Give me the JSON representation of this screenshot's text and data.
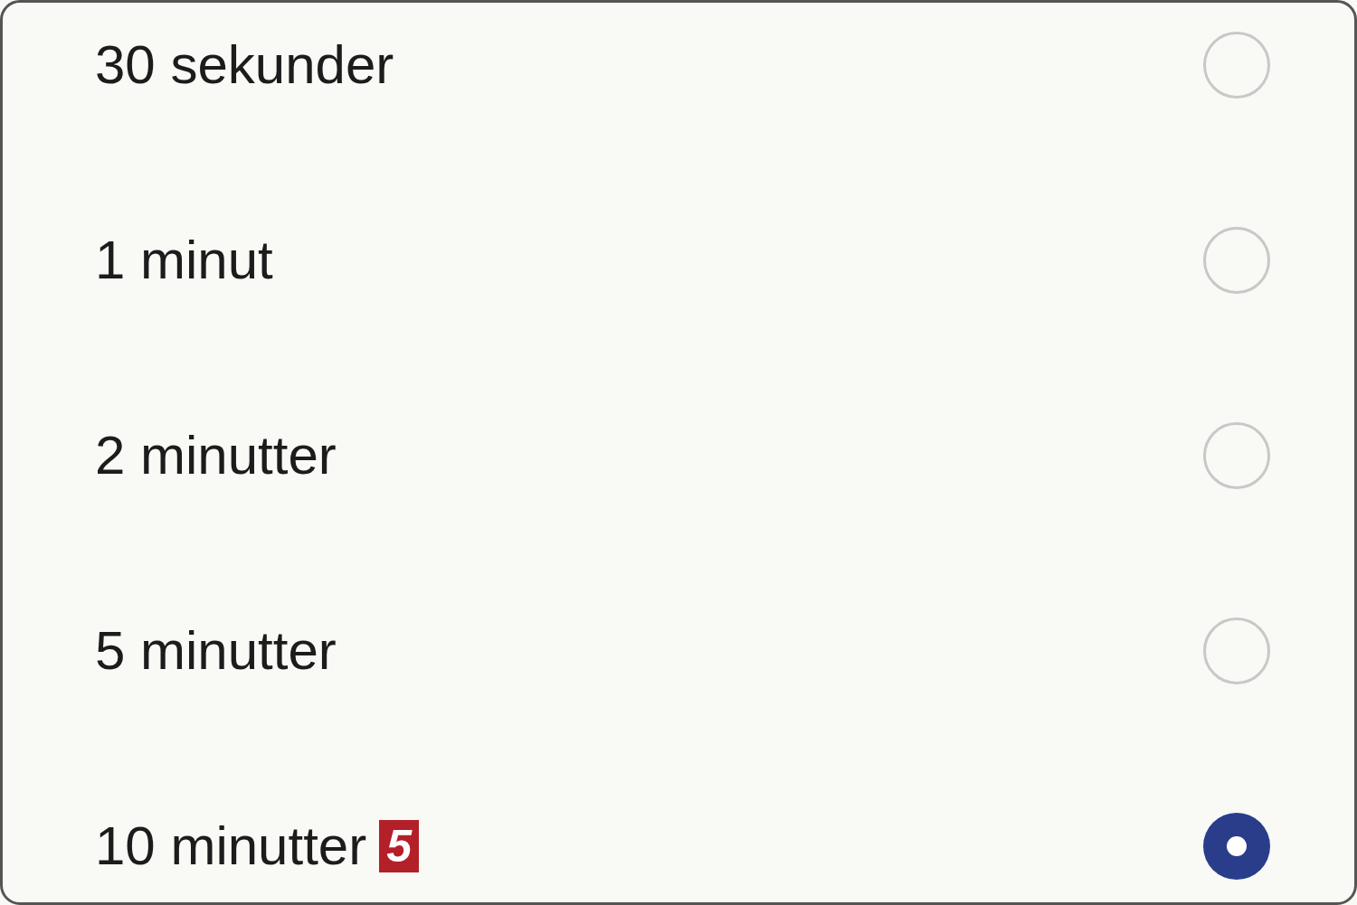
{
  "options": [
    {
      "label": "30 sekunder",
      "selected": false
    },
    {
      "label": "1 minut",
      "selected": false
    },
    {
      "label": "2 minutter",
      "selected": false
    },
    {
      "label": "5 minutter",
      "selected": false
    },
    {
      "label": "10 minutter",
      "selected": true,
      "badge": "5"
    }
  ]
}
